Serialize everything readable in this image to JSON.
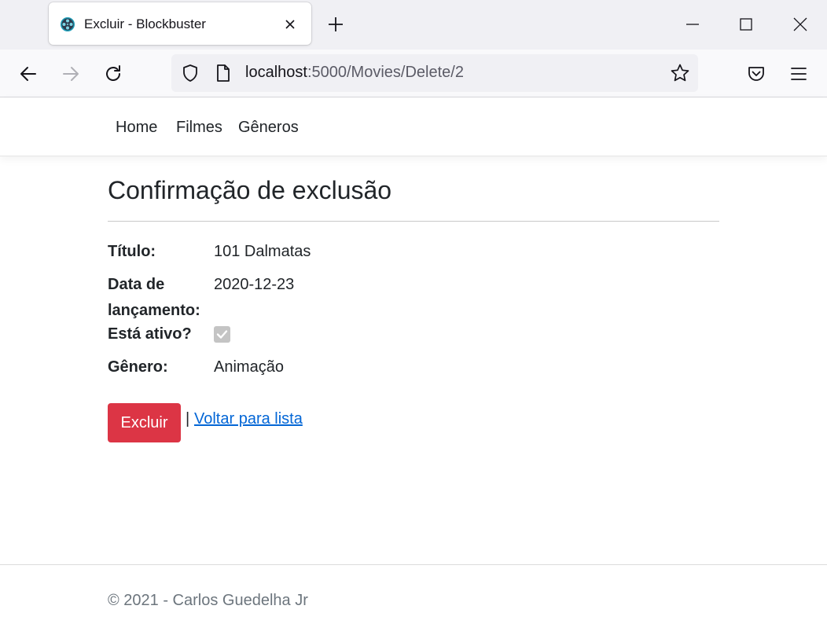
{
  "browser": {
    "tab_title": "Excluir - Blockbuster",
    "url_host": "localhost",
    "url_path": ":5000/Movies/Delete/2"
  },
  "site": {
    "nav": [
      "Home",
      "Filmes",
      "Gêneros"
    ]
  },
  "page": {
    "title": "Confirmação de exclusão",
    "fields": [
      {
        "label_line1": "Título:",
        "label_line2": "",
        "value": "101 Dalmatas"
      },
      {
        "label_line1": "Data de",
        "label_line2": "lançamento:",
        "value": "2020-12-23"
      },
      {
        "label_line1": "Está ativo?",
        "label_line2": "",
        "checked": true
      },
      {
        "label_line1": "Gênero:",
        "label_line2": "",
        "value": "Animação"
      }
    ],
    "delete_button": "Excluir",
    "separator": "|",
    "back_link": "Voltar para lista"
  },
  "footer": {
    "text": "© 2021 - Carlos Guedelha Jr"
  },
  "colors": {
    "danger": "#dc3545",
    "link": "#0366d6",
    "footer_text": "#6c757d"
  }
}
